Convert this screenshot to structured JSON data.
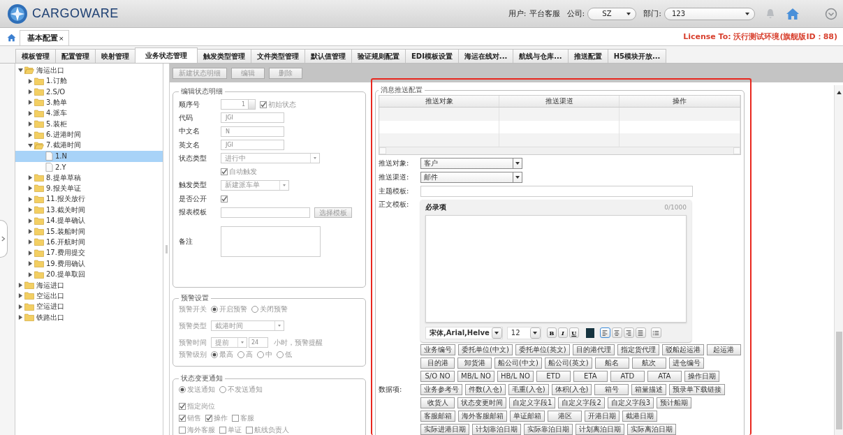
{
  "header": {
    "logo_text": "CARGOWARE",
    "user_label": "用户:",
    "user": "平台客服",
    "company_label": "公司:",
    "company": "SZ",
    "dept_label": "部门:",
    "dept": "123"
  },
  "main_tabs": [
    {
      "label": "基本配置",
      "close": "×",
      "selected": true
    }
  ],
  "license": "License To: 沃行测试环境(旗舰版ID：88)",
  "sub_tabs": [
    {
      "label": "模板管理",
      "selected": false
    },
    {
      "label": "配置管理",
      "selected": false
    },
    {
      "label": "映射管理",
      "selected": false
    },
    {
      "label": "业务状态管理",
      "selected": true
    },
    {
      "label": "触发类型管理",
      "selected": false
    },
    {
      "label": "文件类型管理",
      "selected": false
    },
    {
      "label": "默认值管理",
      "selected": false
    },
    {
      "label": "验证规则配置",
      "selected": false
    },
    {
      "label": "EDI模板设置",
      "selected": false
    },
    {
      "label": "海运在线对...",
      "selected": false
    },
    {
      "label": "航线与仓库...",
      "selected": false
    },
    {
      "label": "推送配置",
      "selected": false
    },
    {
      "label": "H5模块开放...",
      "selected": false
    }
  ],
  "tree": [
    {
      "label": "海运出口",
      "kind": "folder",
      "expanded": true,
      "selected": false,
      "children": [
        {
          "label": "1.订舱",
          "kind": "folder",
          "expanded": false,
          "selected": false
        },
        {
          "label": "2.S/O",
          "kind": "folder",
          "expanded": false,
          "selected": false
        },
        {
          "label": "3.舱单",
          "kind": "folder",
          "expanded": false,
          "selected": false
        },
        {
          "label": "4.派车",
          "kind": "folder",
          "expanded": false,
          "selected": false
        },
        {
          "label": "5.装柜",
          "kind": "folder",
          "expanded": false,
          "selected": false
        },
        {
          "label": "6.进港时间",
          "kind": "folder",
          "expanded": false,
          "selected": false
        },
        {
          "label": "7.截港时间",
          "kind": "folder",
          "expanded": true,
          "selected": false,
          "children": [
            {
              "label": "1.N",
              "kind": "file",
              "selected": true
            },
            {
              "label": "2.Y",
              "kind": "file",
              "selected": false
            }
          ]
        },
        {
          "label": "8.提单草稿",
          "kind": "folder",
          "expanded": false,
          "selected": false
        },
        {
          "label": "9.报关单证",
          "kind": "folder",
          "expanded": false,
          "selected": false
        },
        {
          "label": "11.报关放行",
          "kind": "folder",
          "expanded": false,
          "selected": false
        },
        {
          "label": "13.截关时间",
          "kind": "folder",
          "expanded": false,
          "selected": false
        },
        {
          "label": "14.提单确认",
          "kind": "folder",
          "expanded": false,
          "selected": false
        },
        {
          "label": "15.装船时间",
          "kind": "folder",
          "expanded": false,
          "selected": false
        },
        {
          "label": "16.开航时间",
          "kind": "folder",
          "expanded": false,
          "selected": false
        },
        {
          "label": "17.费用提交",
          "kind": "folder",
          "expanded": false,
          "selected": false
        },
        {
          "label": "19.费用确认",
          "kind": "folder",
          "expanded": false,
          "selected": false
        },
        {
          "label": "20.提单取回",
          "kind": "folder",
          "expanded": false,
          "selected": false
        }
      ]
    },
    {
      "label": "海运进口",
      "kind": "folder",
      "expanded": false,
      "selected": false
    },
    {
      "label": "空运出口",
      "kind": "folder",
      "expanded": false,
      "selected": false
    },
    {
      "label": "空运进口",
      "kind": "folder",
      "expanded": false,
      "selected": false
    },
    {
      "label": "铁路出口",
      "kind": "folder",
      "expanded": false,
      "selected": false
    }
  ],
  "toolbar": [
    {
      "label": "新建状态明细",
      "disabled": true
    },
    {
      "label": "编辑",
      "disabled": true
    },
    {
      "label": "删除",
      "disabled": true
    }
  ],
  "edit_form": {
    "legend": "编辑状态明细",
    "rows": [
      {
        "kind": "spinner",
        "label": "顺序号",
        "value": "1",
        "check_text": "初始状态",
        "checked": true
      },
      {
        "kind": "text",
        "label": "代码",
        "value": "JGI"
      },
      {
        "kind": "text",
        "label": "中文名",
        "value": "N"
      },
      {
        "kind": "text",
        "label": "英文名",
        "value": "JGI"
      },
      {
        "kind": "select",
        "label": "状态类型",
        "value": "进行中"
      },
      {
        "kind": "checkbox",
        "check_text": "自动触发",
        "checked": true
      },
      {
        "kind": "select",
        "label": "触发类型",
        "value": "新建派车单"
      },
      {
        "kind": "checkbox",
        "label": "是否公开",
        "checked": true
      },
      {
        "kind": "chooser",
        "label": "报表模板",
        "button": "选择模板"
      },
      {
        "kind": "textarea",
        "label": "备注"
      }
    ]
  },
  "warning": {
    "legend": "预警设置",
    "switch_label": "预警开关",
    "switch_options": [
      {
        "label": "开启预警",
        "selected": true
      },
      {
        "label": "关闭预警",
        "selected": false
      }
    ],
    "type_label": "预警类型",
    "type_value": "截港时间",
    "time_label": "预警时间",
    "time_mode": "提前",
    "time_value": "24",
    "time_suffix": "小时，预警提醒",
    "level_label": "预警级别",
    "level_options": [
      {
        "label": "最高",
        "selected": true
      },
      {
        "label": "高",
        "selected": false
      },
      {
        "label": "中",
        "selected": false
      },
      {
        "label": "低",
        "selected": false
      }
    ]
  },
  "notify": {
    "legend": "状态变更通知",
    "options": [
      {
        "label": "发送通知",
        "selected": true
      },
      {
        "label": "不发送通知",
        "selected": false
      }
    ],
    "check_rows": [
      [
        {
          "label": "指定岗位",
          "checked": true
        }
      ],
      [
        {
          "label": "销售",
          "checked": true
        },
        {
          "label": "操作",
          "checked": true
        },
        {
          "label": "客服",
          "checked": false
        }
      ],
      [
        {
          "label": "海外客服",
          "checked": false
        },
        {
          "label": "单证",
          "checked": false
        },
        {
          "label": "航线负责人",
          "checked": false
        }
      ]
    ]
  },
  "push": {
    "legend": "消息推送配置",
    "columns": [
      "推送对象",
      "推送渠道",
      "操作"
    ],
    "target_label": "推送对象:",
    "target": "客户",
    "channel_label": "推送渠道:",
    "channel": "邮件",
    "subject_label": "主题模板:",
    "body_label": "正文模板:",
    "editor": {
      "title": "必录项",
      "counter": "0/1000",
      "font": "宋体,Arial,Helve",
      "size": "12",
      "styles": [
        "B",
        "I",
        "U"
      ],
      "align_buttons": [
        {
          "kind": "left",
          "selected": true
        },
        {
          "kind": "center",
          "selected": false
        },
        {
          "kind": "right",
          "selected": false
        },
        {
          "kind": "justify",
          "selected": false
        }
      ]
    },
    "items_label": "数据项:",
    "item_rows": [
      [
        "业务编号",
        "委托单位(中文)",
        "委托单位(英文)",
        "目的港代理",
        "指定货代理",
        "驳船起运港",
        "起运港"
      ],
      [
        "目的港",
        "卸货港",
        "船公司(中文)",
        "船公司(英文)",
        "船名",
        "航次",
        "进仓编号"
      ],
      [
        "S/O NO",
        "MB/L NO",
        "HB/L NO",
        "ETD",
        "ETA",
        "ATD",
        "ATA",
        "操作日期"
      ],
      [
        "业务参考号",
        "件数(入仓)",
        "毛重(入仓)",
        "体积(入仓)",
        "箱号",
        "箱量描述",
        "预录单下载链接"
      ],
      [
        "收货人",
        "状态变更时间",
        "自定义字段1",
        "自定义字段2",
        "自定义字段3",
        "预计船期"
      ],
      [
        "客服邮箱",
        "海外客服邮箱",
        "单证邮箱",
        "港区",
        "开港日期",
        "截港日期"
      ],
      [
        "实际进港日期",
        "计划靠泊日期",
        "实际靠泊日期",
        "计划离泊日期",
        "实际离泊日期"
      ]
    ]
  }
}
